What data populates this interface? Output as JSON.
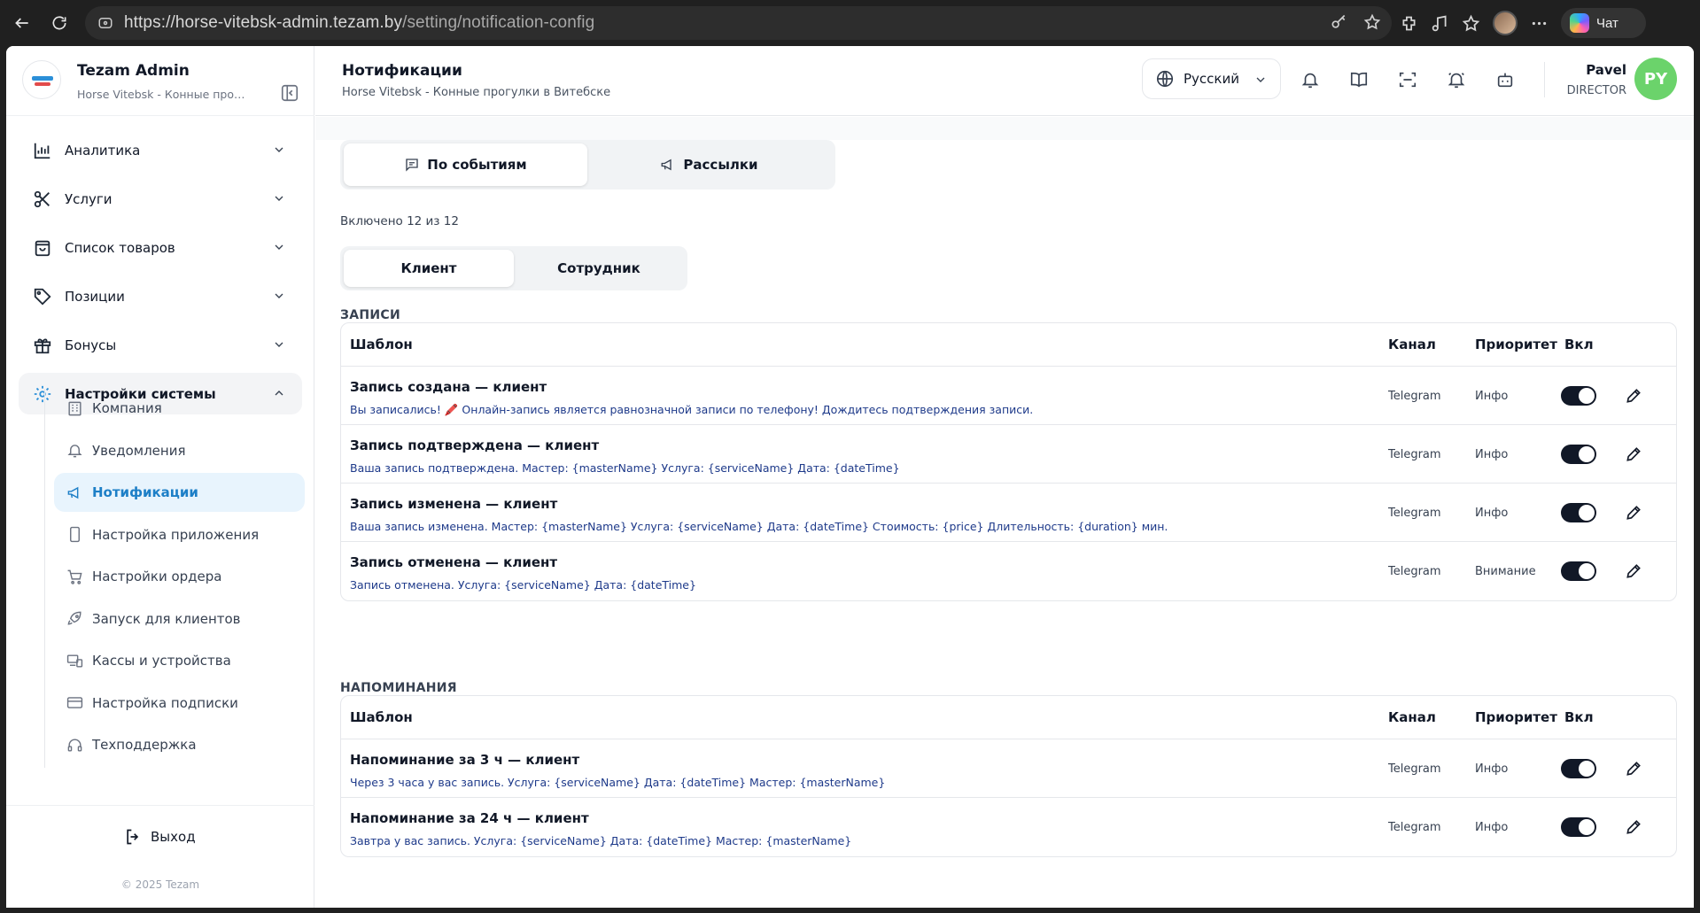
{
  "browser": {
    "url_host": "https://horse-vitebsk-admin.tezam.by",
    "url_path": "/setting/notification-config",
    "chat_label": "Чат"
  },
  "sidebar": {
    "brand_name": "Tezam Admin",
    "brand_sub": "Horse Vitebsk - Конные прогулки в Витебске",
    "menu": [
      {
        "label": "Аналитика",
        "icon": "chart-icon"
      },
      {
        "label": "Услуги",
        "icon": "scissors-icon"
      },
      {
        "label": "Список товаров",
        "icon": "bag-icon"
      },
      {
        "label": "Позиции",
        "icon": "tag-icon"
      },
      {
        "label": "Бонусы",
        "icon": "gift-icon"
      },
      {
        "label": "Настройки системы",
        "icon": "gear-icon",
        "open": true
      }
    ],
    "submenu": [
      {
        "label": "Компания",
        "icon": "building-icon"
      },
      {
        "label": "Уведомления",
        "icon": "bell-icon"
      },
      {
        "label": "Нотификации",
        "icon": "megaphone-icon",
        "active": true
      },
      {
        "label": "Настройка приложения",
        "icon": "phone-icon"
      },
      {
        "label": "Настройки ордера",
        "icon": "cart-icon"
      },
      {
        "label": "Запуск для клиентов",
        "icon": "rocket-icon"
      },
      {
        "label": "Кассы и устройства",
        "icon": "devices-icon"
      },
      {
        "label": "Настройка подписки",
        "icon": "card-icon"
      },
      {
        "label": "Техподдержка",
        "icon": "headset-icon"
      }
    ],
    "logout": "Выход",
    "copyright": "© 2025 Tezam"
  },
  "header": {
    "title": "Нотификации",
    "subtitle": "Horse Vitebsk - Конные прогулки в Витебске",
    "language": "Русский",
    "user_name": "Pavel",
    "user_role": "DIRECTOR",
    "user_initials": "PY"
  },
  "tabs": {
    "events": "По событиям",
    "mailings": "Рассылки"
  },
  "enabled_count": "Включено 12 из 12",
  "audience_tabs": {
    "client": "Клиент",
    "employee": "Сотрудник"
  },
  "columns": {
    "template": "Шаблон",
    "channel": "Канал",
    "priority": "Приоритет",
    "enabled": "Вкл"
  },
  "sections": [
    {
      "title": "ЗАПИСИ",
      "rows": [
        {
          "title": "Запись создана — клиент",
          "desc": "Вы записались! 🖍️ Онлайн-запись является равнозначной записи по телефону! Дождитесь подтверждения записи.",
          "channel": "Telegram",
          "priority": "Инфо",
          "enabled": true
        },
        {
          "title": "Запись подтверждена — клиент",
          "desc": "Ваша запись подтверждена. Мастер: {masterName} Услуга: {serviceName} Дата: {dateTime}",
          "channel": "Telegram",
          "priority": "Инфо",
          "enabled": true
        },
        {
          "title": "Запись изменена — клиент",
          "desc": "Ваша запись изменена. Мастер: {masterName} Услуга: {serviceName} Дата: {dateTime} Стоимость: {price} Длительность: {duration} мин.",
          "channel": "Telegram",
          "priority": "Инфо",
          "enabled": true
        },
        {
          "title": "Запись отменена — клиент",
          "desc": "Запись отменена. Услуга: {serviceName} Дата: {dateTime}",
          "channel": "Telegram",
          "priority": "Внимание",
          "enabled": true
        }
      ]
    },
    {
      "title": "НАПОМИНАНИЯ",
      "rows": [
        {
          "title": "Напоминание за 3 ч — клиент",
          "desc": "Через 3 часа у вас запись. Услуга: {serviceName} Дата: {dateTime} Мастер: {masterName}",
          "channel": "Telegram",
          "priority": "Инфо",
          "enabled": true
        },
        {
          "title": "Напоминание за 24 ч — клиент",
          "desc": "Завтра у вас запись. Услуга: {serviceName} Дата: {dateTime} Мастер: {masterName}",
          "channel": "Telegram",
          "priority": "Инфо",
          "enabled": true
        }
      ]
    }
  ],
  "colors": {
    "accent": "#2b8fd8",
    "active_bg": "#e8f4fd",
    "toggle_on": "#111827",
    "avatar": "#6bd36b"
  }
}
